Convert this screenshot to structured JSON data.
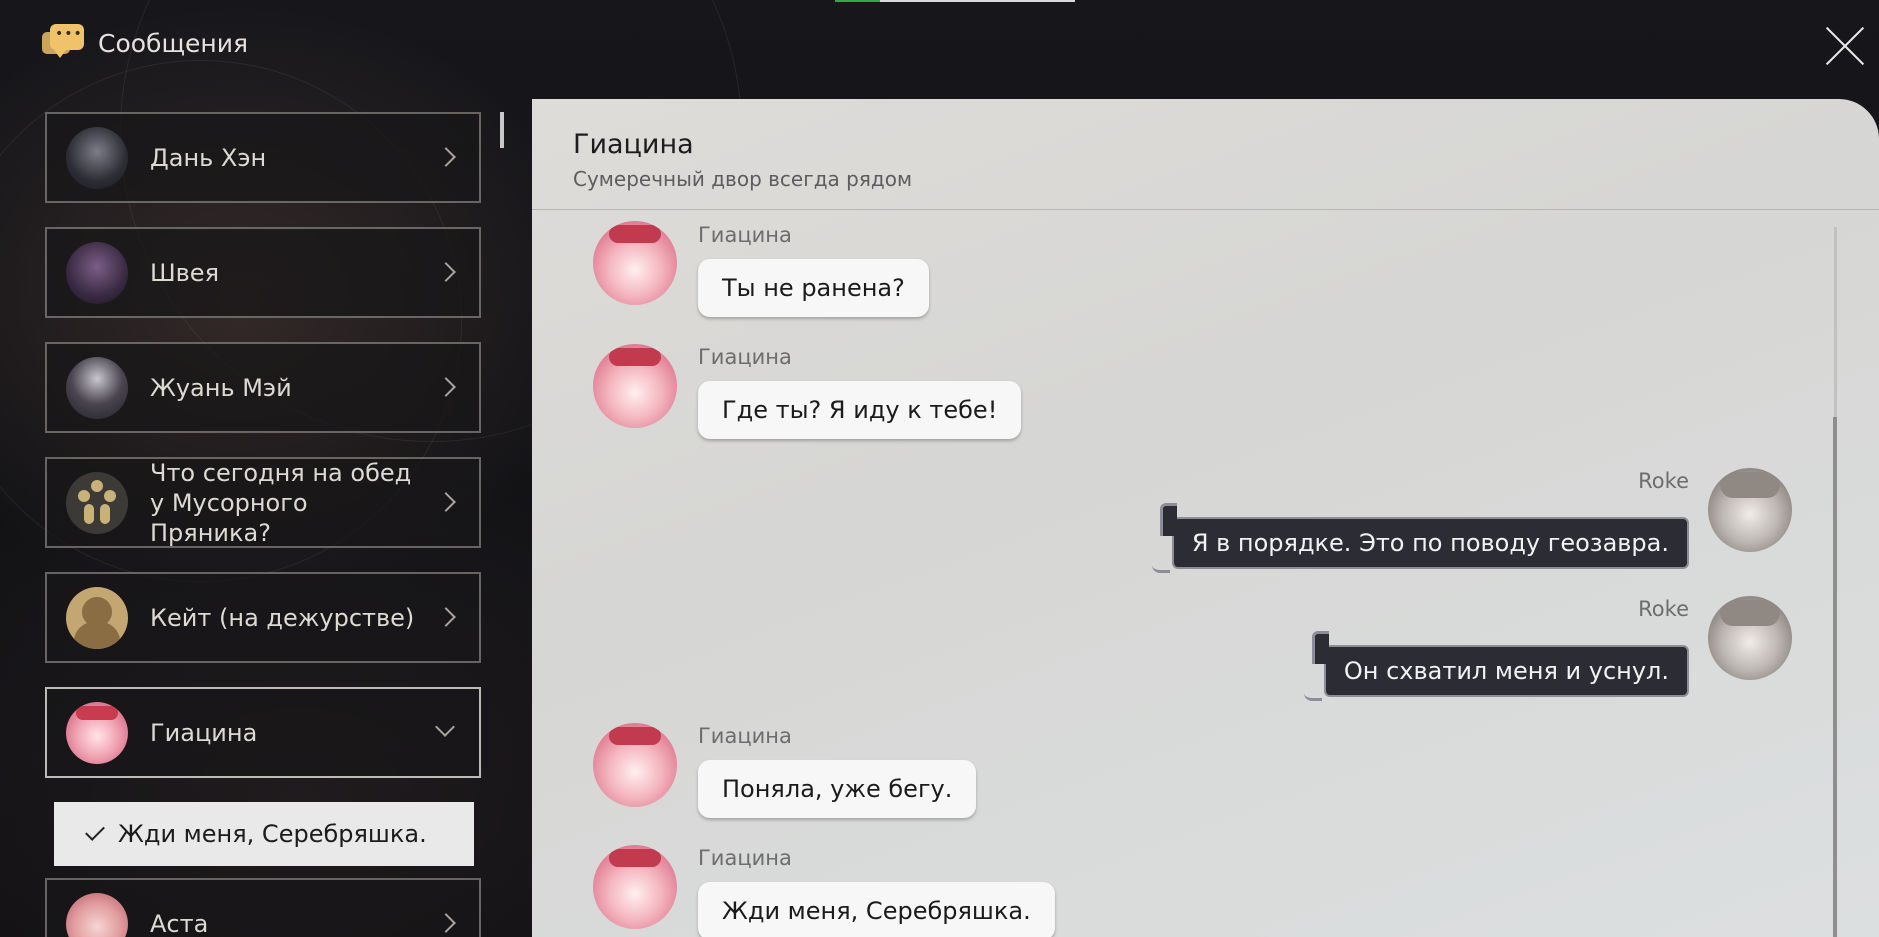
{
  "header": {
    "title": "Сообщения",
    "icon": "message-bubbles-icon",
    "icon_color": "#f0c36a"
  },
  "contacts": [
    {
      "name": "Дань Хэн"
    },
    {
      "name": "Швея"
    },
    {
      "name": "Жуань Мэй"
    },
    {
      "name": "Что сегодня на обед у Мусорного Пряника?"
    },
    {
      "name": "Кейт (на дежурстве)"
    },
    {
      "name": "Гиацина"
    },
    {
      "name": "Аста"
    }
  ],
  "selected_option": "Жди меня, Серебряшка.",
  "chat": {
    "name": "Гиацина",
    "subtitle": "Сумеречный двор всегда рядом",
    "messages": [
      {
        "sender": "Гиацина",
        "text": "Ты не ранена?",
        "side": "in"
      },
      {
        "sender": "Гиацина",
        "text": "Где ты? Я иду к тебе!",
        "side": "in"
      },
      {
        "sender": "Roke",
        "text": "Я в порядке. Это по поводу геозавра.",
        "side": "out"
      },
      {
        "sender": "Roke",
        "text": "Он схватил меня и уснул.",
        "side": "out"
      },
      {
        "sender": "Гиацина",
        "text": "Поняла, уже бегу.",
        "side": "in"
      },
      {
        "sender": "Гиацина",
        "text": "Жди меня, Серебряшка.",
        "side": "in"
      }
    ]
  },
  "colors": {
    "panel_bg": "#d8d8d6",
    "bubble_in": "#f7f7f7",
    "bubble_out": "#2c2c34",
    "accent": "#f0c36a"
  }
}
